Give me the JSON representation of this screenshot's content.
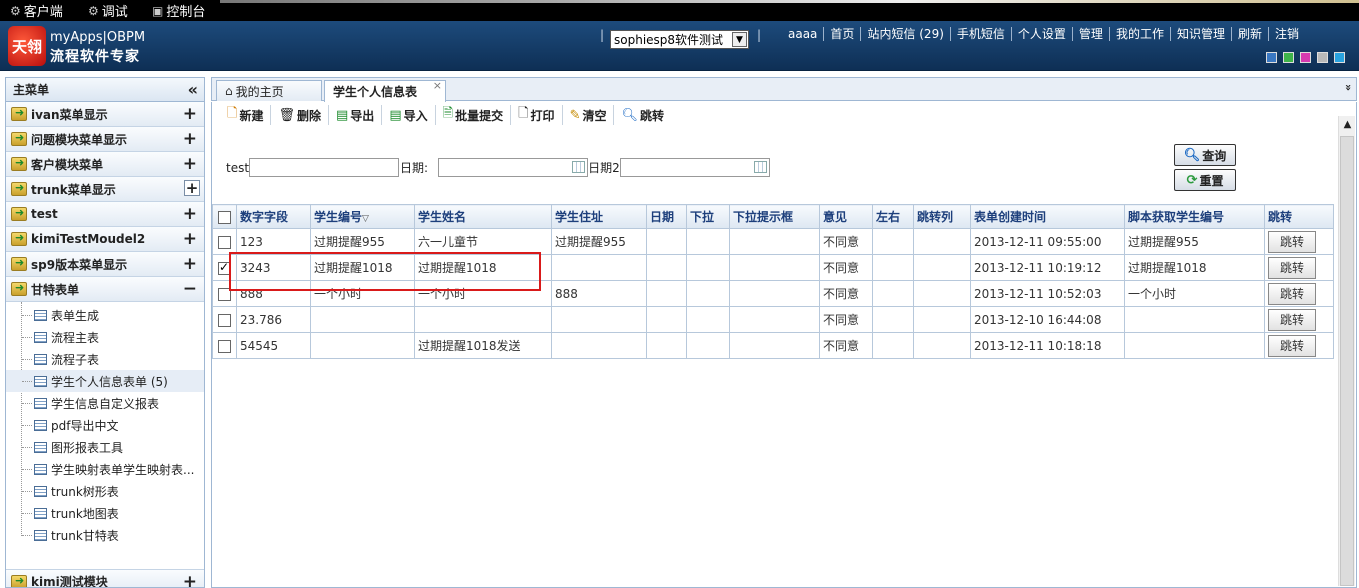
{
  "topbar": {
    "items": [
      "客户端",
      "调试",
      "控制台"
    ]
  },
  "header": {
    "logo_mark": "天翎",
    "brand_line1": "myApps|OBPM",
    "brand_line2": "流程软件专家",
    "domain_select": "sophiesp8软件测试",
    "nav_links": [
      "aaaa",
      "首页",
      "站内短信 (29)",
      "手机短信",
      "个人设置",
      "管理",
      "我的工作",
      "知识管理",
      "刷新",
      "注销"
    ],
    "theme_colors": [
      "#3a78c2",
      "#3fb44a",
      "#d63ab0",
      "#b9b9b9",
      "#29a3e0"
    ]
  },
  "sidebar": {
    "title": "主菜单",
    "collapse_icon": "«",
    "groups": [
      {
        "label": "ivan菜单显示",
        "toggle": "+"
      },
      {
        "label": "问题模块菜单显示",
        "toggle": "+"
      },
      {
        "label": "客户模块菜单",
        "toggle": "+"
      },
      {
        "label": "trunk菜单显示",
        "toggle": "+"
      },
      {
        "label": "test",
        "toggle": "+"
      },
      {
        "label": "kimiTestMoudel2",
        "toggle": "+"
      },
      {
        "label": "sp9版本菜单显示",
        "toggle": "+"
      },
      {
        "label": "甘特表单",
        "toggle": "−"
      }
    ],
    "sub_items": [
      "表单生成",
      "流程主表",
      "流程子表",
      "学生个人信息表单 (5)",
      "学生信息自定义报表",
      "pdf导出中文",
      "图形报表工具",
      "学生映射表单学生映射表...",
      "trunk树形表",
      "trunk地图表",
      "trunk甘特表"
    ],
    "bottom_group": {
      "label": "kimi测试模块",
      "toggle": "+"
    }
  },
  "tabs": [
    {
      "label": "我的主页"
    },
    {
      "label": "学生个人信息表",
      "close": "×"
    }
  ],
  "tab_more": "»",
  "toolbar": [
    "新建",
    "删除",
    "导出",
    "导入",
    "批量提交",
    "打印",
    "清空",
    "跳转"
  ],
  "search": {
    "test_label": "test",
    "date_label": "日期:",
    "date2_label": "日期2",
    "query_label": "查询",
    "reset_label": "重置"
  },
  "grid": {
    "columns": [
      "数字字段",
      "学生编号",
      "学生姓名",
      "学生住址",
      "日期",
      "下拉",
      "下拉提示框",
      "意见",
      "左右",
      "跳转列",
      "表单创建时间",
      "脚本获取学生编号",
      "跳转"
    ],
    "sort_marker": "▽",
    "rows": [
      {
        "checked": false,
        "cells": [
          "123",
          "过期提醒955",
          "六一儿童节",
          "过期提醒955",
          "",
          "",
          "",
          "不同意",
          "",
          "",
          "2013-12-11 09:55:00",
          "过期提醒955"
        ],
        "action": "跳转"
      },
      {
        "checked": true,
        "cells": [
          "3243",
          "过期提醒1018",
          "过期提醒1018",
          "",
          "",
          "",
          "",
          "不同意",
          "",
          "",
          "2013-12-11 10:19:12",
          "过期提醒1018"
        ],
        "action": "跳转"
      },
      {
        "checked": false,
        "cells": [
          "888",
          "一个小时",
          "一个小时",
          "888",
          "",
          "",
          "",
          "不同意",
          "",
          "",
          "2013-12-11 10:52:03",
          "一个小时"
        ],
        "action": "跳转"
      },
      {
        "checked": false,
        "cells": [
          "23.786",
          "",
          "",
          "",
          "",
          "",
          "",
          "不同意",
          "",
          "",
          "2013-12-10 16:44:08",
          ""
        ],
        "action": "跳转"
      },
      {
        "checked": false,
        "cells": [
          "54545",
          "",
          "过期提醒1018发送",
          "",
          "",
          "",
          "",
          "不同意",
          "",
          "",
          "2013-12-11 10:18:18",
          ""
        ],
        "action": "跳转"
      }
    ]
  }
}
